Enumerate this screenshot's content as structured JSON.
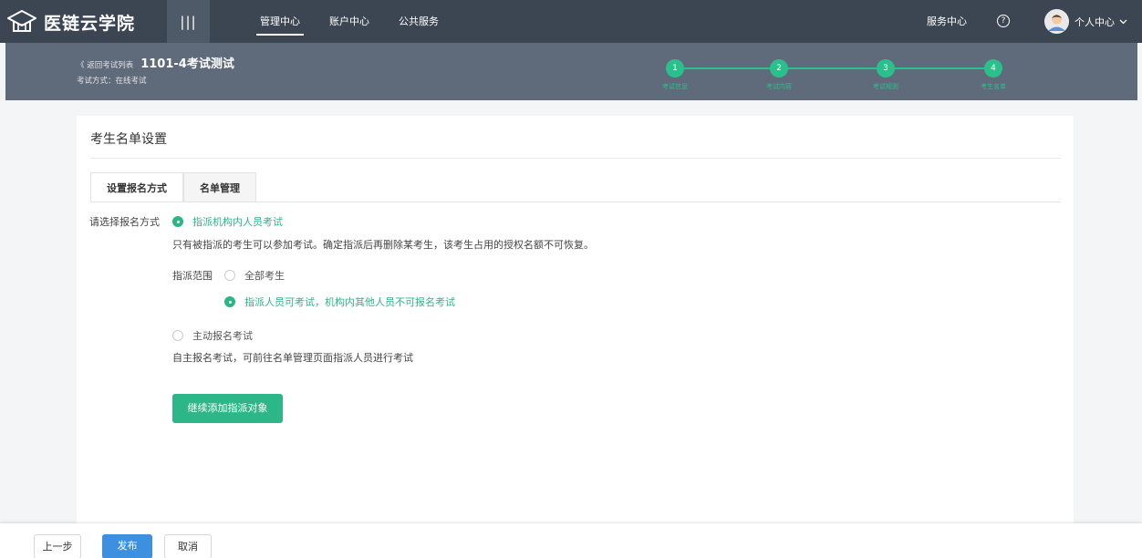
{
  "brand": {
    "name": "医链云学院",
    "menu_toggle": "|||"
  },
  "nav": {
    "items": [
      {
        "label": "管理中心",
        "active": true
      },
      {
        "label": "账户中心",
        "active": false
      },
      {
        "label": "公共服务",
        "active": false
      }
    ]
  },
  "header_right": {
    "service": "服务中心",
    "help_glyph": "?",
    "user_label": "个人中心"
  },
  "subheader": {
    "back_link": "《 返回考试列表",
    "exam_title": "1101-4考试测试",
    "exam_mode": "考试方式：在线考试",
    "steps": [
      {
        "num": "1",
        "label": "考试信息"
      },
      {
        "num": "2",
        "label": "考试内容"
      },
      {
        "num": "3",
        "label": "考试规则"
      },
      {
        "num": "4",
        "label": "考生名单"
      }
    ]
  },
  "card": {
    "title": "考生名单设置",
    "tabs": [
      {
        "label": "设置报名方式",
        "active": true
      },
      {
        "label": "名单管理",
        "active": false
      }
    ],
    "field_label": "请选择报名方式",
    "option_assign": "指派机构内人员考试",
    "option_assign_note": "只有被指派的考生可以参加考试。确定指派后再删除某考生，该考生占用的授权名额不可恢复。",
    "scope_label": "指派范围",
    "scope_all": "全部考生",
    "scope_assigned": "指派人员可考试，机构内其他人员不可报名考试",
    "option_self": "主动报名考试",
    "option_self_note": "自主报名考试，可前往名单管理页面指派人员进行考试",
    "add_button": "继续添加指派对象"
  },
  "footer": {
    "prev": "上一步",
    "publish": "发布",
    "cancel": "取消"
  },
  "colors": {
    "topbar": "#3c4552",
    "subheader": "#5f6b7b",
    "accent_green": "#2bb686",
    "publish_blue": "#3d8fe0"
  }
}
